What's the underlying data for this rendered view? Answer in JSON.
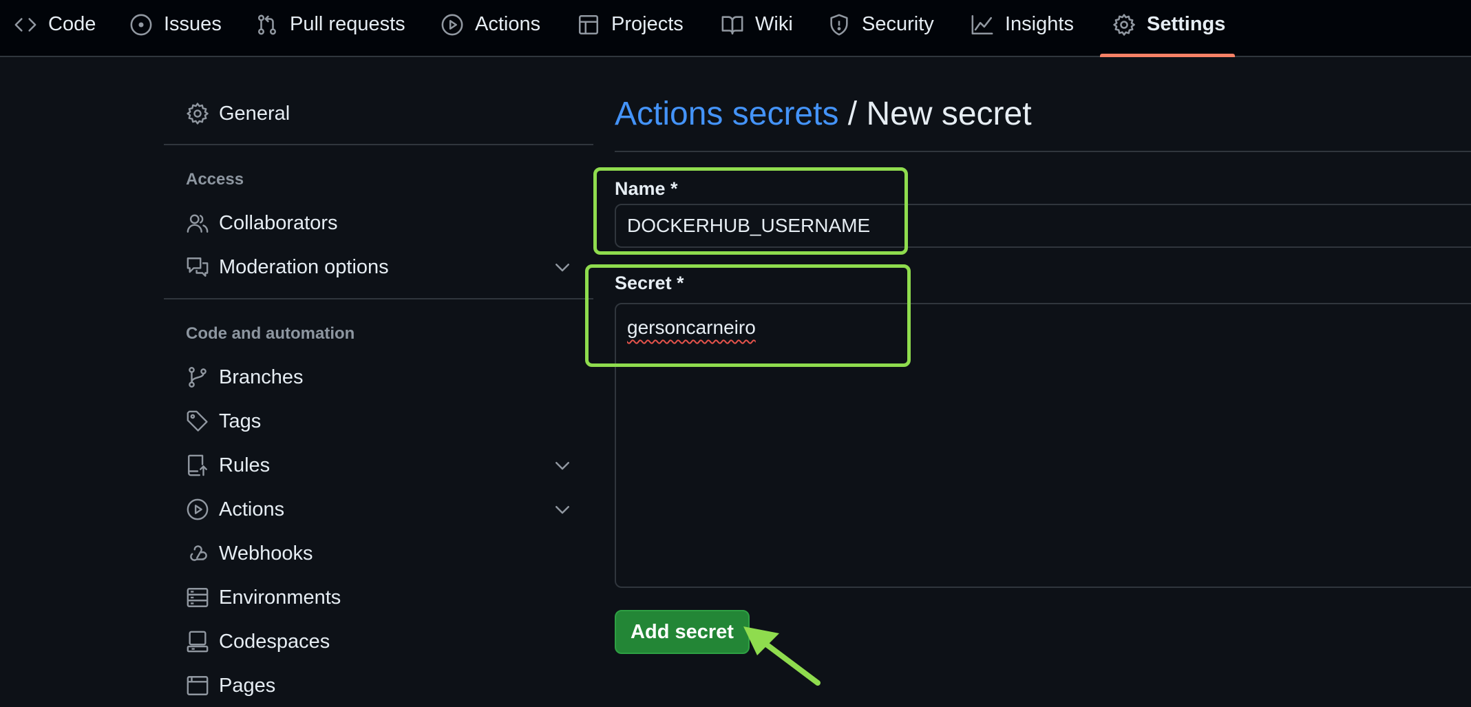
{
  "topnav": {
    "tabs": [
      {
        "label": "Code",
        "icon": "code-icon"
      },
      {
        "label": "Issues",
        "icon": "issue-opened-icon"
      },
      {
        "label": "Pull requests",
        "icon": "git-pull-request-icon"
      },
      {
        "label": "Actions",
        "icon": "play-icon"
      },
      {
        "label": "Projects",
        "icon": "table-icon"
      },
      {
        "label": "Wiki",
        "icon": "book-icon"
      },
      {
        "label": "Security",
        "icon": "shield-icon"
      },
      {
        "label": "Insights",
        "icon": "graph-icon"
      },
      {
        "label": "Settings",
        "icon": "gear-icon",
        "active": true
      }
    ],
    "active_underline_color": "#f78166"
  },
  "sidebar": {
    "general": {
      "label": "General",
      "icon": "gear-icon"
    },
    "access": {
      "heading": "Access",
      "items": [
        {
          "label": "Collaborators",
          "icon": "people-icon"
        },
        {
          "label": "Moderation options",
          "icon": "comment-discussion-icon",
          "expandable": true
        }
      ]
    },
    "code_automation": {
      "heading": "Code and automation",
      "items": [
        {
          "label": "Branches",
          "icon": "git-branch-icon"
        },
        {
          "label": "Tags",
          "icon": "tag-icon"
        },
        {
          "label": "Rules",
          "icon": "repo-push-icon",
          "expandable": true
        },
        {
          "label": "Actions",
          "icon": "play-icon",
          "expandable": true
        },
        {
          "label": "Webhooks",
          "icon": "webhook-icon"
        },
        {
          "label": "Environments",
          "icon": "server-icon"
        },
        {
          "label": "Codespaces",
          "icon": "codespaces-icon"
        },
        {
          "label": "Pages",
          "icon": "browser-icon"
        }
      ]
    }
  },
  "main": {
    "breadcrumb_link": "Actions secrets",
    "breadcrumb_sep": " / ",
    "breadcrumb_current": "New secret",
    "name_label": "Name *",
    "name_value": "DOCKERHUB_USERNAME",
    "secret_label": "Secret *",
    "secret_value": "gersoncarneiro",
    "submit_label": "Add secret"
  },
  "colors": {
    "background": "#0d1117",
    "topbar": "#010409",
    "link": "#4493f8",
    "button_green": "#238636",
    "highlight_green": "#8fdc4e"
  }
}
